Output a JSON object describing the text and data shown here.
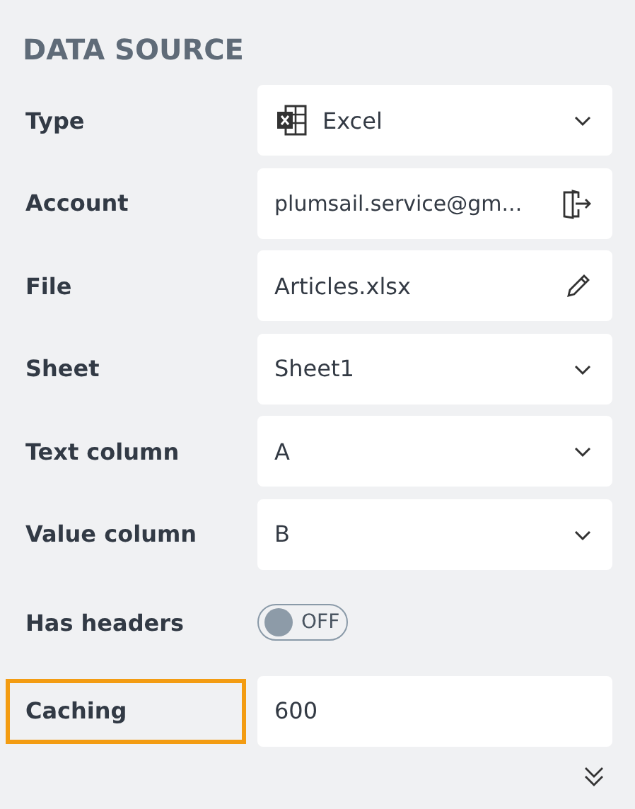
{
  "section_title": "DATA SOURCE",
  "fields": [
    {
      "label": "Type",
      "kind": "type_select",
      "value": "Excel",
      "highlighted": false
    },
    {
      "label": "Account",
      "kind": "account",
      "value": "plumsail.service@gm...",
      "highlighted": false
    },
    {
      "label": "File",
      "kind": "file",
      "value": "Articles.xlsx",
      "highlighted": false
    },
    {
      "label": "Sheet",
      "kind": "select",
      "value": "Sheet1",
      "highlighted": false
    },
    {
      "label": "Text column",
      "kind": "select",
      "value": "A",
      "highlighted": false
    },
    {
      "label": "Value column",
      "kind": "select",
      "value": "B",
      "highlighted": false
    },
    {
      "label": "Has headers",
      "kind": "toggle",
      "on": false,
      "state_text": "OFF",
      "highlighted": false
    },
    {
      "label": "Caching",
      "kind": "text",
      "value": "600",
      "highlighted": true
    }
  ]
}
